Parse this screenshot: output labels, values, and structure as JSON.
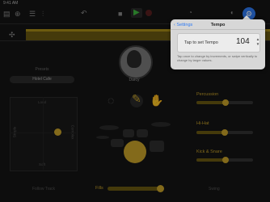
{
  "status": {
    "time": "9:41 AM"
  },
  "toolbar": {
    "icons": [
      "tracks-icon",
      "mixer-icon",
      "undo-icon",
      "stop-icon",
      "play-icon",
      "record-icon",
      "metronome-icon",
      "settings-icon",
      "help-icon"
    ]
  },
  "drummer": {
    "name": "Darcy",
    "preset_label": "Presets",
    "preset_value": "Hotel Cafe"
  },
  "pad": {
    "top": "Loud",
    "bottom": "Soft",
    "left": "Simple",
    "right": "Complex"
  },
  "parts": {
    "percussion": "Percussion",
    "hihat": "Hi-Hat",
    "kick_snare": "Kick & Snare"
  },
  "bottom": {
    "follow": "Follow Track",
    "fills": "Fills",
    "swing": "Swing"
  },
  "popover": {
    "back": "Settings",
    "title": "Tempo",
    "tap_label": "Tap to set Tempo",
    "tempo": "104",
    "description": "Tap once to change by increments, or swipe vertically to change by larger values."
  },
  "colors": {
    "accent": "#c9a32a",
    "ruler": "#a88d18",
    "link": "#2f7bf5"
  }
}
